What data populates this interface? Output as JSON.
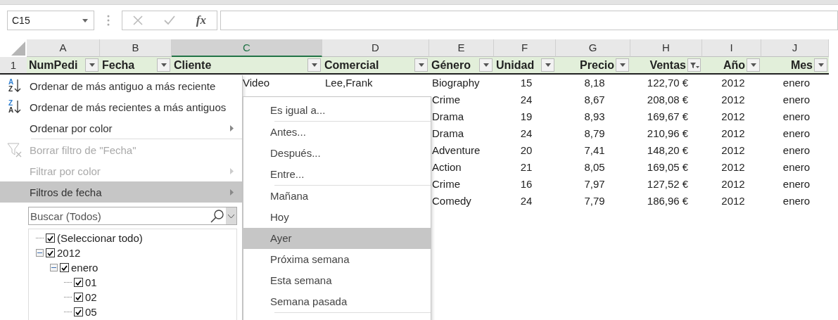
{
  "formula_bar": {
    "name_box": "C15",
    "fx_label": "fx"
  },
  "columns": [
    {
      "letter": "A",
      "selected": false
    },
    {
      "letter": "B",
      "selected": false
    },
    {
      "letter": "C",
      "selected": true
    },
    {
      "letter": "D",
      "selected": false
    },
    {
      "letter": "E",
      "selected": false
    },
    {
      "letter": "F",
      "selected": false
    },
    {
      "letter": "G",
      "selected": false
    },
    {
      "letter": "H",
      "selected": false
    },
    {
      "letter": "I",
      "selected": false
    },
    {
      "letter": "J",
      "selected": false
    }
  ],
  "header_row": {
    "number": "1",
    "cells": [
      {
        "text": "NumPedi",
        "filtered": false
      },
      {
        "text": "Fecha",
        "filtered": false
      },
      {
        "text": "Cliente",
        "filtered": false
      },
      {
        "text": "Comercial",
        "filtered": false
      },
      {
        "text": "Género",
        "filtered": false
      },
      {
        "text": "Unidad",
        "filtered": false
      },
      {
        "text": "Precio",
        "filtered": false
      },
      {
        "text": "Ventas",
        "filtered": true
      },
      {
        "text": "Año",
        "filtered": false
      },
      {
        "text": "Mes",
        "filtered": false
      }
    ]
  },
  "rows": [
    {
      "C": "Video",
      "D": "Lee,Frank",
      "E": "Biography",
      "F": "15",
      "G": "8,18",
      "H": "122,70 €",
      "I": "2012",
      "J": "enero"
    },
    {
      "E": "Crime",
      "F": "24",
      "G": "8,67",
      "H": "208,08 €",
      "I": "2012",
      "J": "enero"
    },
    {
      "E": "Drama",
      "F": "19",
      "G": "8,93",
      "H": "169,67 €",
      "I": "2012",
      "J": "enero"
    },
    {
      "E": "Drama",
      "F": "24",
      "G": "8,79",
      "H": "210,96 €",
      "I": "2012",
      "J": "enero"
    },
    {
      "E": "Adventure",
      "F": "20",
      "G": "7,41",
      "H": "148,20 €",
      "I": "2012",
      "J": "enero"
    },
    {
      "E": "Action",
      "F": "21",
      "G": "8,05",
      "H": "169,05 €",
      "I": "2012",
      "J": "enero"
    },
    {
      "E": "Crime",
      "F": "16",
      "G": "7,97",
      "H": "127,52 €",
      "I": "2012",
      "J": "enero"
    },
    {
      "E": "Comedy",
      "F": "24",
      "G": "7,79",
      "H": "186,96 €",
      "I": "2012",
      "J": "enero"
    }
  ],
  "filter_menu": {
    "groups": [
      [
        {
          "kind": "sort",
          "icon_top": "A",
          "icon_bottom": "Z",
          "label": "Ordenar de más antiguo a más reciente",
          "disabled": false,
          "selected": false,
          "submenu": false
        },
        {
          "kind": "sort",
          "icon_top": "Z",
          "icon_bottom": "A",
          "label": "Ordenar de más recientes a más antiguos",
          "disabled": false,
          "selected": false,
          "submenu": false
        },
        {
          "kind": "plain",
          "label": "Ordenar por color",
          "disabled": false,
          "selected": false,
          "submenu": true
        }
      ],
      [
        {
          "kind": "clear-filter",
          "label": "Borrar filtro de \"Fecha\"",
          "disabled": true,
          "selected": false,
          "submenu": false
        },
        {
          "kind": "plain",
          "label": "Filtrar por color",
          "disabled": true,
          "selected": false,
          "submenu": true
        },
        {
          "kind": "plain",
          "label": "Filtros de fecha",
          "disabled": false,
          "selected": true,
          "submenu": true
        }
      ]
    ],
    "search": {
      "placeholder": "Buscar (Todos)"
    },
    "tree": [
      {
        "label": "(Seleccionar todo)",
        "checked": true
      },
      {
        "label": "2012",
        "checked": true,
        "expanded": true,
        "children": [
          {
            "label": "enero",
            "checked": true,
            "expanded": true,
            "children": [
              {
                "label": "01",
                "checked": true
              },
              {
                "label": "02",
                "checked": true
              },
              {
                "label": "05",
                "checked": true
              }
            ]
          }
        ]
      }
    ]
  },
  "date_submenu": {
    "groups": [
      [
        {
          "label": "Es igual a...",
          "selected": false
        }
      ],
      [
        {
          "label": "Antes...",
          "selected": false
        },
        {
          "label": "Después...",
          "selected": false
        },
        {
          "label": "Entre...",
          "selected": false
        }
      ],
      [
        {
          "label": "Mañana",
          "selected": false
        },
        {
          "label": "Hoy",
          "selected": false
        },
        {
          "label": "Ayer",
          "selected": true
        },
        {
          "label": "Próxima semana",
          "selected": false
        },
        {
          "label": "Esta semana",
          "selected": false
        },
        {
          "label": "Semana pasada",
          "selected": false
        }
      ]
    ]
  }
}
